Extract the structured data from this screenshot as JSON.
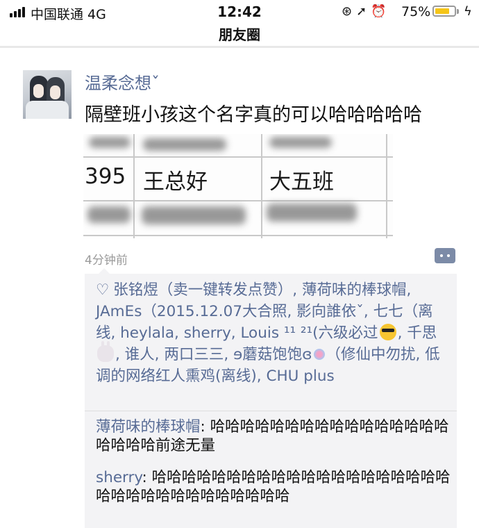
{
  "status_bar": {
    "carrier": "中国联通  4G",
    "time": "12:42",
    "icons": [
      "lock-rotation-icon",
      "location-icon",
      "alarm-icon"
    ],
    "battery_percent_text": "75%",
    "battery_level": 0.75
  },
  "nav": {
    "title": "朋友圈"
  },
  "post": {
    "username": "温柔念想ˇ",
    "text": "隔壁班小孩这个名字真的可以哈哈哈哈哈",
    "image": {
      "cells": [
        "395",
        "王总好",
        "大五班"
      ]
    },
    "timestamp": "4分钟前"
  },
  "likes": {
    "names_part1": "张铭煜（卖一键转发点赞）, 薄荷味的棒球帽, JAmEs（2015.12.07大合照, 影向誰依ˇ, 七七（离线, heylala, sherry, Louis ¹¹ ²¹(六级必过",
    "names_part2": ", 千思",
    "names_part3": ", 谁人, 两口三三, ɘ蘑菇饱饱ɞ",
    "names_part4": "（修仙中勿扰, 低调的网络红人熏鸡(离线), CHU plus"
  },
  "comments": [
    {
      "author": "薄荷味的棒球帽",
      "text": "哈哈哈哈哈哈哈哈哈哈哈哈哈哈哈哈哈哈哈哈前途无量"
    },
    {
      "author": "sherry",
      "text": "哈哈哈哈哈哈哈哈哈哈哈哈哈哈哈哈哈哈哈哈哈哈哈哈哈哈哈哈哈哈哈哈哈"
    }
  ],
  "colors": {
    "link": "#576b95",
    "panel_bg": "#f3f3f5",
    "battery": "#f5c518"
  }
}
